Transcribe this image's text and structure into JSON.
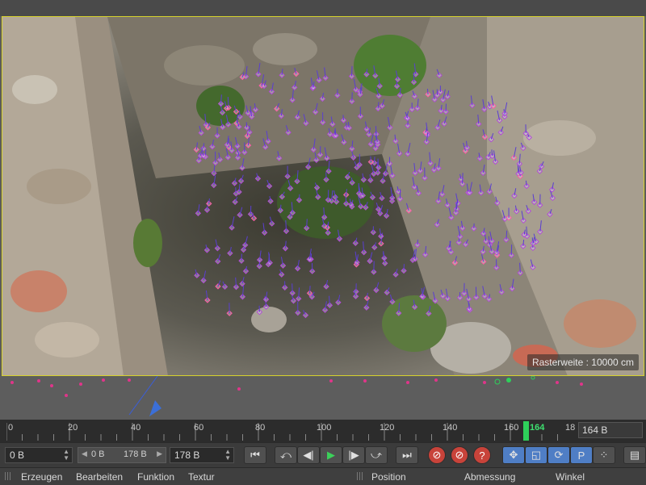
{
  "viewport": {
    "grid_label": "Rasterweite : 10000 cm",
    "background_color": "#5b5b5b",
    "frame_color": "#d6d22c",
    "tracker_colors": [
      "#b14bd8",
      "#5a3fd0",
      "#ff5aa8"
    ]
  },
  "timeline": {
    "ticks": [
      "0",
      "20",
      "40",
      "60",
      "80",
      "100",
      "120",
      "140",
      "160",
      "18"
    ],
    "current_frame": "164",
    "frame_display": "164 B",
    "current_frame_color": "#2ed05a"
  },
  "transport": {
    "start_field": "0 B",
    "range_start": "0 B",
    "range_end": "178 B",
    "end_field": "178 B",
    "buttons": {
      "go_start": "⏮",
      "prev_key": "⤺",
      "prev_frame": "◀|",
      "play": "▶",
      "next_frame": "|▶",
      "next_key": "⤻",
      "go_end": "⏭",
      "record": "⊘",
      "autokey": "⊘",
      "help": "?",
      "move": "✥",
      "scale": "◱",
      "rotate": "⟳",
      "param": "P",
      "points": "⁘",
      "film": "▤"
    }
  },
  "menubar": {
    "items": [
      "Erzeugen",
      "Bearbeiten",
      "Funktion",
      "Textur"
    ],
    "panels": [
      "Position",
      "Abmessung",
      "Winkel"
    ]
  }
}
